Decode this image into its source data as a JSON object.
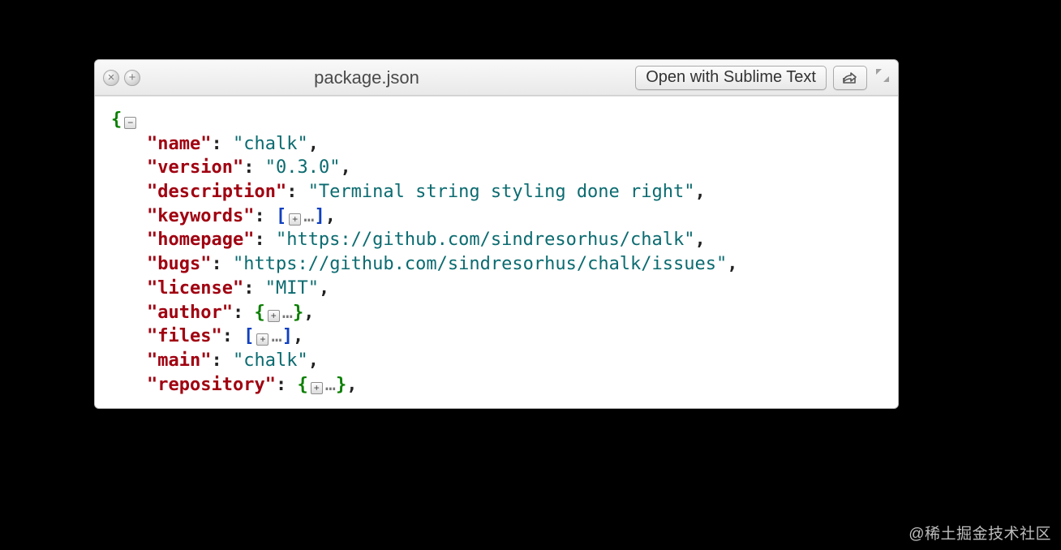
{
  "titlebar": {
    "filename": "package.json",
    "open_with_label": "Open with Sublime Text"
  },
  "fold": {
    "collapse": "−",
    "expand": "+",
    "ellipsis": "…"
  },
  "json": {
    "entries": [
      {
        "key": "name",
        "type": "string",
        "value": "chalk"
      },
      {
        "key": "version",
        "type": "string",
        "value": "0.3.0"
      },
      {
        "key": "description",
        "type": "string",
        "value": "Terminal string styling done right"
      },
      {
        "key": "keywords",
        "type": "array_collapsed"
      },
      {
        "key": "homepage",
        "type": "string",
        "value": "https://github.com/sindresorhus/chalk"
      },
      {
        "key": "bugs",
        "type": "string",
        "value": "https://github.com/sindresorhus/chalk/issues"
      },
      {
        "key": "license",
        "type": "string",
        "value": "MIT"
      },
      {
        "key": "author",
        "type": "object_collapsed"
      },
      {
        "key": "files",
        "type": "array_collapsed"
      },
      {
        "key": "main",
        "type": "string",
        "value": "chalk"
      },
      {
        "key": "repository",
        "type": "object_collapsed"
      }
    ]
  },
  "watermark": "@稀土掘金技术社区"
}
